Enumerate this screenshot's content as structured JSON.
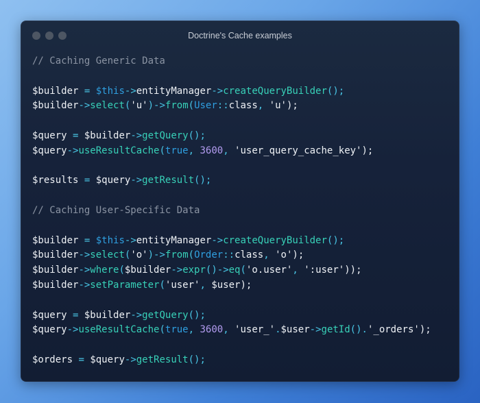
{
  "window": {
    "title": "Doctrine's Cache examples",
    "dots": [
      "close",
      "minimize",
      "maximize"
    ]
  },
  "colors": {
    "background_gradient": [
      "#8fc0f0",
      "#2a63c2"
    ],
    "window_bg": "#16223a",
    "comment": "#8b94a3",
    "operator": "#49c6e5",
    "keyword": "#2f9fe0",
    "method": "#38d1b8",
    "number": "#b39cf0",
    "text": "#eef1f5"
  },
  "code_lines": [
    [
      {
        "t": "// Caching Generic Data",
        "c": "comment"
      }
    ],
    [],
    [
      {
        "t": "$builder",
        "c": "var"
      },
      {
        "t": " = ",
        "c": "op"
      },
      {
        "t": "$this",
        "c": "kw"
      },
      {
        "t": "->",
        "c": "op"
      },
      {
        "t": "entityManager",
        "c": "plain"
      },
      {
        "t": "->",
        "c": "op"
      },
      {
        "t": "createQueryBuilder",
        "c": "method"
      },
      {
        "t": "();",
        "c": "op"
      }
    ],
    [
      {
        "t": "$builder",
        "c": "var"
      },
      {
        "t": "->",
        "c": "op"
      },
      {
        "t": "select",
        "c": "method"
      },
      {
        "t": "(",
        "c": "op"
      },
      {
        "t": "'u'",
        "c": "str"
      },
      {
        "t": ")->",
        "c": "op"
      },
      {
        "t": "from",
        "c": "method"
      },
      {
        "t": "(",
        "c": "op"
      },
      {
        "t": "User",
        "c": "class"
      },
      {
        "t": "::",
        "c": "op"
      },
      {
        "t": "class",
        "c": "plain"
      },
      {
        "t": ", ",
        "c": "op"
      },
      {
        "t": "'u'",
        "c": "str"
      },
      {
        "t": ");",
        "c": "plain"
      }
    ],
    [],
    [
      {
        "t": "$query",
        "c": "var"
      },
      {
        "t": " = ",
        "c": "op"
      },
      {
        "t": "$builder",
        "c": "var"
      },
      {
        "t": "->",
        "c": "op"
      },
      {
        "t": "getQuery",
        "c": "method"
      },
      {
        "t": "();",
        "c": "op"
      }
    ],
    [
      {
        "t": "$query",
        "c": "var"
      },
      {
        "t": "->",
        "c": "op"
      },
      {
        "t": "useResultCache",
        "c": "method"
      },
      {
        "t": "(",
        "c": "op"
      },
      {
        "t": "true",
        "c": "kw"
      },
      {
        "t": ", ",
        "c": "op"
      },
      {
        "t": "3600",
        "c": "num"
      },
      {
        "t": ", ",
        "c": "op"
      },
      {
        "t": "'user_query_cache_key'",
        "c": "str"
      },
      {
        "t": ");",
        "c": "plain"
      }
    ],
    [],
    [
      {
        "t": "$results",
        "c": "var"
      },
      {
        "t": " = ",
        "c": "op"
      },
      {
        "t": "$query",
        "c": "var"
      },
      {
        "t": "->",
        "c": "op"
      },
      {
        "t": "getResult",
        "c": "method"
      },
      {
        "t": "();",
        "c": "op"
      }
    ],
    [],
    [
      {
        "t": "// Caching User-Specific Data",
        "c": "comment"
      }
    ],
    [],
    [
      {
        "t": "$builder",
        "c": "var"
      },
      {
        "t": " = ",
        "c": "op"
      },
      {
        "t": "$this",
        "c": "kw"
      },
      {
        "t": "->",
        "c": "op"
      },
      {
        "t": "entityManager",
        "c": "plain"
      },
      {
        "t": "->",
        "c": "op"
      },
      {
        "t": "createQueryBuilder",
        "c": "method"
      },
      {
        "t": "();",
        "c": "op"
      }
    ],
    [
      {
        "t": "$builder",
        "c": "var"
      },
      {
        "t": "->",
        "c": "op"
      },
      {
        "t": "select",
        "c": "method"
      },
      {
        "t": "(",
        "c": "op"
      },
      {
        "t": "'o'",
        "c": "str"
      },
      {
        "t": ")->",
        "c": "op"
      },
      {
        "t": "from",
        "c": "method"
      },
      {
        "t": "(",
        "c": "op"
      },
      {
        "t": "Order",
        "c": "class"
      },
      {
        "t": "::",
        "c": "op"
      },
      {
        "t": "class",
        "c": "plain"
      },
      {
        "t": ", ",
        "c": "op"
      },
      {
        "t": "'o'",
        "c": "str"
      },
      {
        "t": ");",
        "c": "plain"
      }
    ],
    [
      {
        "t": "$builder",
        "c": "var"
      },
      {
        "t": "->",
        "c": "op"
      },
      {
        "t": "where",
        "c": "method"
      },
      {
        "t": "(",
        "c": "op"
      },
      {
        "t": "$builder",
        "c": "var"
      },
      {
        "t": "->",
        "c": "op"
      },
      {
        "t": "expr",
        "c": "method"
      },
      {
        "t": "()->",
        "c": "op"
      },
      {
        "t": "eq",
        "c": "method"
      },
      {
        "t": "(",
        "c": "op"
      },
      {
        "t": "'o.user'",
        "c": "str"
      },
      {
        "t": ", ",
        "c": "op"
      },
      {
        "t": "':user'",
        "c": "str"
      },
      {
        "t": "));",
        "c": "plain"
      }
    ],
    [
      {
        "t": "$builder",
        "c": "var"
      },
      {
        "t": "->",
        "c": "op"
      },
      {
        "t": "setParameter",
        "c": "method"
      },
      {
        "t": "(",
        "c": "op"
      },
      {
        "t": "'user'",
        "c": "str"
      },
      {
        "t": ", ",
        "c": "op"
      },
      {
        "t": "$user",
        "c": "var"
      },
      {
        "t": ");",
        "c": "plain"
      }
    ],
    [],
    [
      {
        "t": "$query",
        "c": "var"
      },
      {
        "t": " = ",
        "c": "op"
      },
      {
        "t": "$builder",
        "c": "var"
      },
      {
        "t": "->",
        "c": "op"
      },
      {
        "t": "getQuery",
        "c": "method"
      },
      {
        "t": "();",
        "c": "op"
      }
    ],
    [
      {
        "t": "$query",
        "c": "var"
      },
      {
        "t": "->",
        "c": "op"
      },
      {
        "t": "useResultCache",
        "c": "method"
      },
      {
        "t": "(",
        "c": "op"
      },
      {
        "t": "true",
        "c": "kw"
      },
      {
        "t": ", ",
        "c": "op"
      },
      {
        "t": "3600",
        "c": "num"
      },
      {
        "t": ", ",
        "c": "op"
      },
      {
        "t": "'user_'",
        "c": "str"
      },
      {
        "t": ".",
        "c": "op"
      },
      {
        "t": "$user",
        "c": "var"
      },
      {
        "t": "->",
        "c": "op"
      },
      {
        "t": "getId",
        "c": "method"
      },
      {
        "t": "().",
        "c": "op"
      },
      {
        "t": "'_orders'",
        "c": "str"
      },
      {
        "t": ");",
        "c": "plain"
      }
    ],
    [],
    [
      {
        "t": "$orders",
        "c": "var"
      },
      {
        "t": " = ",
        "c": "op"
      },
      {
        "t": "$query",
        "c": "var"
      },
      {
        "t": "->",
        "c": "op"
      },
      {
        "t": "getResult",
        "c": "method"
      },
      {
        "t": "();",
        "c": "op"
      }
    ]
  ]
}
